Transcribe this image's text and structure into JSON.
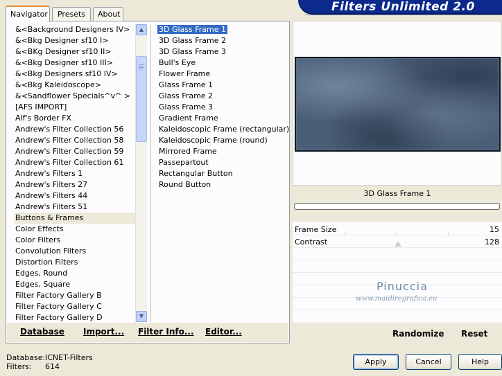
{
  "tabs": [
    {
      "label": "Navigator",
      "active": true
    },
    {
      "label": "Presets",
      "active": false
    },
    {
      "label": "About",
      "active": false
    }
  ],
  "title": "Filters Unlimited 2.0",
  "categories": [
    {
      "label": "&<Background Designers IV>",
      "selected": false
    },
    {
      "label": "&<Bkg Designer sf10 I>",
      "selected": false
    },
    {
      "label": "&<BKg Designer sf10 II>",
      "selected": false
    },
    {
      "label": "&<Bkg Designer sf10 III>",
      "selected": false
    },
    {
      "label": "&<Bkg Designers sf10 IV>",
      "selected": false
    },
    {
      "label": "&<Bkg Kaleidoscope>",
      "selected": false
    },
    {
      "label": "&<Sandflower Specials^v^ >",
      "selected": false
    },
    {
      "label": "[AFS IMPORT]",
      "selected": false
    },
    {
      "label": "Alf's Border FX",
      "selected": false
    },
    {
      "label": "Andrew's Filter Collection 56",
      "selected": false
    },
    {
      "label": "Andrew's Filter Collection 58",
      "selected": false
    },
    {
      "label": "Andrew's Filter Collection 59",
      "selected": false
    },
    {
      "label": "Andrew's Filter Collection 61",
      "selected": false
    },
    {
      "label": "Andrew's Filters 1",
      "selected": false
    },
    {
      "label": "Andrew's Filters 27",
      "selected": false
    },
    {
      "label": "Andrew's Filters 44",
      "selected": false
    },
    {
      "label": "Andrew's Filters 51",
      "selected": false
    },
    {
      "label": "Buttons & Frames",
      "selected": true
    },
    {
      "label": "Color Effects",
      "selected": false
    },
    {
      "label": "Color Filters",
      "selected": false
    },
    {
      "label": "Convolution Filters",
      "selected": false
    },
    {
      "label": "Distortion Filters",
      "selected": false
    },
    {
      "label": "Edges, Round",
      "selected": false
    },
    {
      "label": "Edges, Square",
      "selected": false
    },
    {
      "label": "Filter Factory Gallery B",
      "selected": false
    },
    {
      "label": "Filter Factory Gallery C",
      "selected": false
    },
    {
      "label": "Filter Factory Gallery D",
      "selected": false
    }
  ],
  "filters": [
    {
      "label": "3D Glass Frame 1",
      "selected": true,
      "grip": false
    },
    {
      "label": "3D Glass Frame 2",
      "selected": false,
      "grip": false
    },
    {
      "label": "3D Glass Frame 3",
      "selected": false,
      "grip": false
    },
    {
      "label": "Bull's Eye",
      "selected": false,
      "grip": false
    },
    {
      "label": "Flower Frame",
      "selected": false,
      "grip": true
    },
    {
      "label": "Glass Frame 1",
      "selected": false,
      "grip": false
    },
    {
      "label": "Glass Frame 2",
      "selected": false,
      "grip": false
    },
    {
      "label": "Glass Frame 3",
      "selected": false,
      "grip": false
    },
    {
      "label": "Gradient Frame",
      "selected": false,
      "grip": true
    },
    {
      "label": "Kaleidoscopic Frame (rectangular)",
      "selected": false,
      "grip": false
    },
    {
      "label": "Kaleidoscopic Frame (round)",
      "selected": false,
      "grip": false
    },
    {
      "label": "Mirrored Frame",
      "selected": false,
      "grip": false
    },
    {
      "label": "Passepartout",
      "selected": false,
      "grip": true
    },
    {
      "label": "Rectangular Button",
      "selected": false,
      "grip": false
    },
    {
      "label": "Round Button",
      "selected": false,
      "grip": false
    }
  ],
  "bottom_links": {
    "database": "Database",
    "import": "Import...",
    "filter_info": "Filter Info...",
    "editor": "Editor..."
  },
  "preview": {
    "filter_name": "3D Glass Frame 1",
    "params": [
      {
        "label": "Frame Size",
        "value": "15"
      },
      {
        "label": "Contrast",
        "value": "128"
      }
    ],
    "watermark_name": "Pinuccia",
    "watermark_url": "www.maidiregrafica.eu"
  },
  "right_links": {
    "randomize": "Randomize",
    "reset": "Reset"
  },
  "status": {
    "database_label": "Database:",
    "database_value": "ICNET-Filters",
    "filters_label": "Filters:",
    "filters_value": "614"
  },
  "dialog_buttons": {
    "apply": "Apply",
    "cancel": "Cancel",
    "help": "Help"
  },
  "colors": {
    "banner": "#0c2a8c",
    "selection": "#316ac5",
    "window_bg": "#ece9d8"
  },
  "icons": {
    "scroll_up": "arrow-up-icon",
    "scroll_down": "arrow-down-icon"
  }
}
